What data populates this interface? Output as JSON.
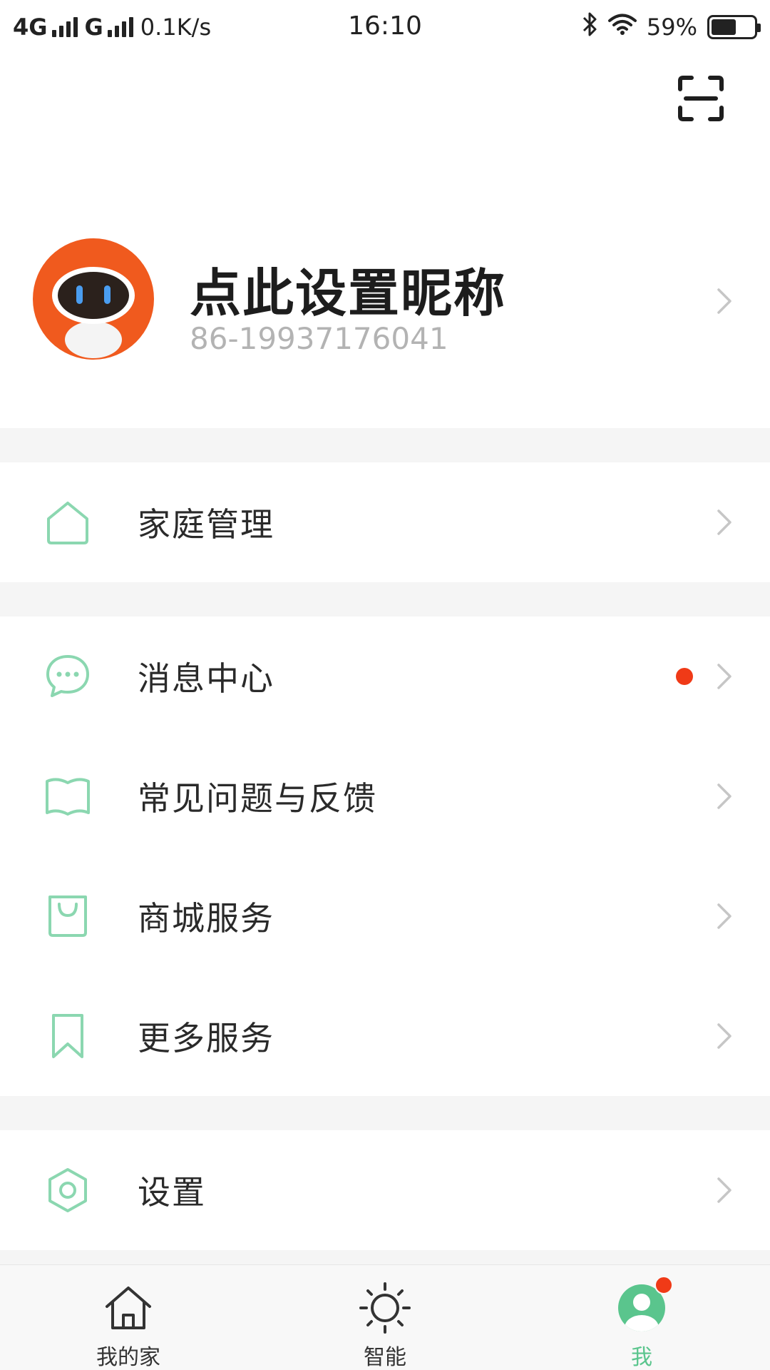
{
  "status_bar": {
    "network_1": "4G",
    "network_2": "G",
    "speed": "0.1K/s",
    "time": "16:10",
    "battery_percent": "59%",
    "battery_level": 0.59,
    "icons": [
      "signal-icon",
      "bluetooth-icon",
      "wifi-icon",
      "battery-icon"
    ]
  },
  "header": {
    "scan_icon": "scan-icon"
  },
  "profile": {
    "nickname": "点此设置昵称",
    "phone": "86-19937176041",
    "avatar_icon": "robot-avatar"
  },
  "menu": {
    "family": {
      "label": "家庭管理",
      "icon": "home-icon"
    },
    "messages": {
      "label": "消息中心",
      "icon": "chat-icon",
      "has_unread": true
    },
    "faq": {
      "label": "常见问题与反馈",
      "icon": "book-icon"
    },
    "store": {
      "label": "商城服务",
      "icon": "shopping-bag-icon"
    },
    "more": {
      "label": "更多服务",
      "icon": "bookmark-icon"
    },
    "settings": {
      "label": "设置",
      "icon": "settings-icon"
    }
  },
  "tabbar": {
    "home": {
      "label": "我的家",
      "icon": "house-icon"
    },
    "smart": {
      "label": "智能",
      "icon": "sun-icon"
    },
    "me": {
      "label": "我",
      "icon": "user-icon",
      "active": true,
      "badge": true
    }
  },
  "colors": {
    "accent": "#5ac58d",
    "badge": "#f03a17",
    "divider": "#f5f5f5",
    "avatar_orange": "#f05a1e"
  }
}
